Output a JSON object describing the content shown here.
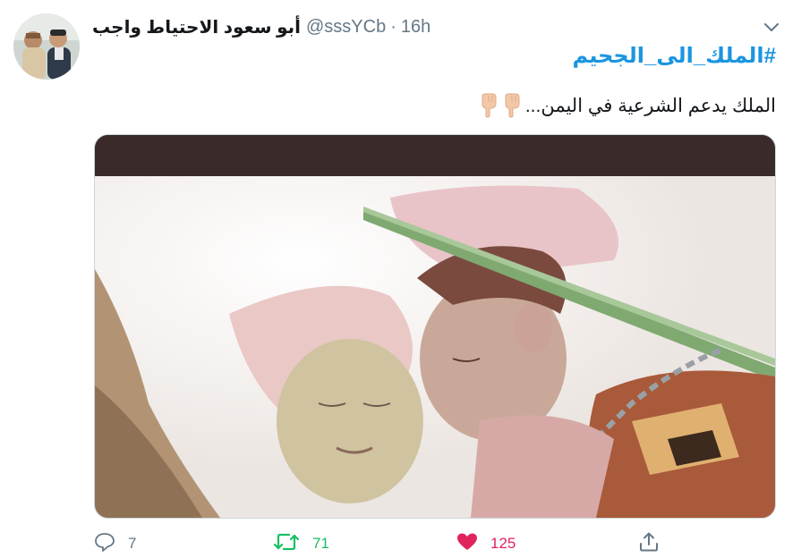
{
  "author": {
    "display_name": "أبو سعود الاحتياط واجب",
    "handle": "@sssYCb",
    "separator": "·",
    "time": "16h"
  },
  "tweet": {
    "hashtag": "#الملك_الى_الجحيم",
    "text": "الملك يدعم الشرعية في اليمن..."
  },
  "actions": {
    "reply_count": "7",
    "retweet_count": "71",
    "like_count": "125"
  },
  "colors": {
    "link": "#1b95e0",
    "secondary_text": "#657786",
    "retweet_green": "#17bf63",
    "like_pink": "#e0245e"
  },
  "icons": [
    "caret-down-icon",
    "pointing-down-hand-icon",
    "reply-icon",
    "retweet-icon",
    "heart-icon",
    "share-icon"
  ]
}
